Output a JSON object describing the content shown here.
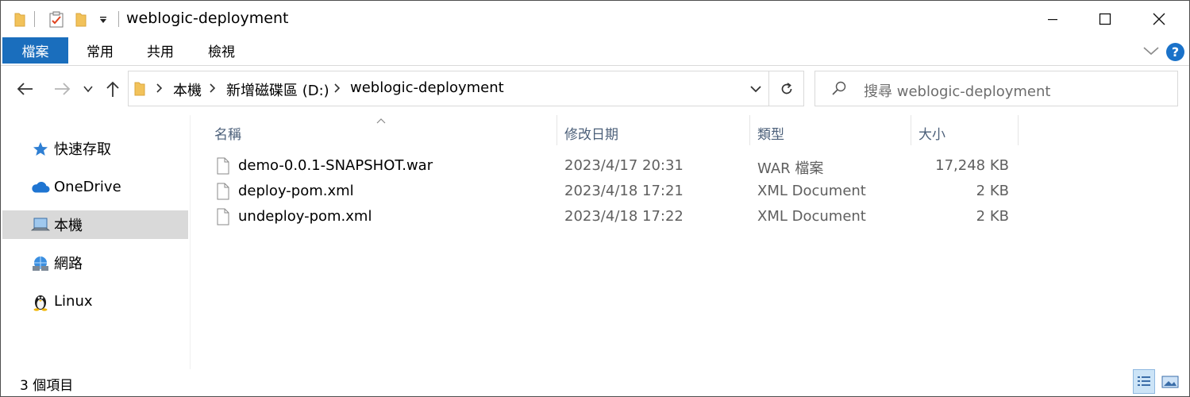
{
  "window": {
    "title": "weblogic-deployment"
  },
  "ribbon": {
    "tabs": [
      "檔案",
      "常用",
      "共用",
      "檢視"
    ],
    "help_label": "?"
  },
  "address": {
    "crumbs": [
      "本機",
      "新增磁碟區 (D:)",
      "weblogic-deployment"
    ]
  },
  "search": {
    "placeholder": "搜尋 weblogic-deployment"
  },
  "sidebar": {
    "items": [
      {
        "label": "快速存取",
        "icon": "star-icon"
      },
      {
        "label": "OneDrive",
        "icon": "cloud-icon"
      },
      {
        "label": "本機",
        "icon": "computer-icon",
        "selected": true
      },
      {
        "label": "網路",
        "icon": "network-icon"
      },
      {
        "label": "Linux",
        "icon": "linux-penguin-icon"
      }
    ]
  },
  "columns": {
    "name": "名稱",
    "date": "修改日期",
    "type": "類型",
    "size": "大小"
  },
  "files": [
    {
      "name": "demo-0.0.1-SNAPSHOT.war",
      "date": "2023/4/17 20:31",
      "type": "WAR 檔案",
      "size": "17,248 KB"
    },
    {
      "name": "deploy-pom.xml",
      "date": "2023/4/18 17:21",
      "type": "XML Document",
      "size": "2 KB"
    },
    {
      "name": "undeploy-pom.xml",
      "date": "2023/4/18 17:22",
      "type": "XML Document",
      "size": "2 KB"
    }
  ],
  "status": {
    "item_count": "3 個項目"
  },
  "colors": {
    "accent": "#1a6ebd",
    "selection": "#d9d9d9",
    "header_text": "#4c607a",
    "folder": "#f2c25a"
  }
}
